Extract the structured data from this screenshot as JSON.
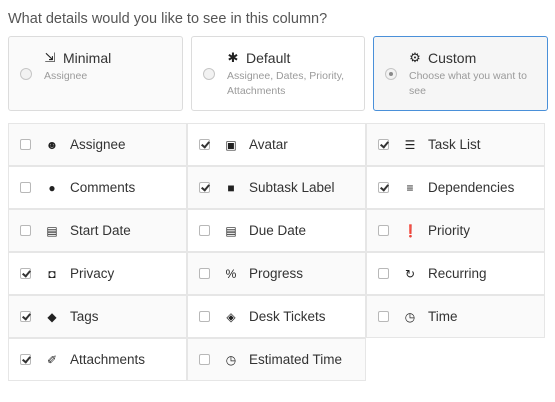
{
  "question": "What details would you like to see in this column?",
  "presets": [
    {
      "title": "Minimal",
      "description": "Assignee",
      "icon": "compress-arrows-icon",
      "glyph": "⇲",
      "selected": false
    },
    {
      "title": "Default",
      "description": "Assignee, Dates, Priority, Attachments",
      "icon": "asterisk-icon",
      "glyph": "✱",
      "selected": false
    },
    {
      "title": "Custom",
      "description": "Choose what you want to see",
      "icon": "gear-icon",
      "glyph": "⚙",
      "selected": true
    }
  ],
  "fields": [
    {
      "label": "Assignee",
      "icon": "user-icon",
      "glyph": "☻",
      "checked": false
    },
    {
      "label": "Avatar",
      "icon": "camera-icon",
      "glyph": "▣",
      "checked": true
    },
    {
      "label": "Task List",
      "icon": "list-icon",
      "glyph": "☰",
      "checked": true
    },
    {
      "label": "Comments",
      "icon": "comment-icon",
      "glyph": "●",
      "checked": false
    },
    {
      "label": "Subtask Label",
      "icon": "square-icon",
      "glyph": "■",
      "checked": true
    },
    {
      "label": "Dependencies",
      "icon": "dependencies-icon",
      "glyph": "≡",
      "checked": true
    },
    {
      "label": "Start Date",
      "icon": "calendar-icon",
      "glyph": "▤",
      "checked": false
    },
    {
      "label": "Due Date",
      "icon": "calendar-icon",
      "glyph": "▤",
      "checked": false
    },
    {
      "label": "Priority",
      "icon": "exclamation-circle-icon",
      "glyph": "❗",
      "checked": false
    },
    {
      "label": "Privacy",
      "icon": "lock-icon",
      "glyph": "◘",
      "checked": true
    },
    {
      "label": "Progress",
      "icon": "percent-icon",
      "glyph": "%",
      "checked": false
    },
    {
      "label": "Recurring",
      "icon": "refresh-icon",
      "glyph": "↻",
      "checked": false
    },
    {
      "label": "Tags",
      "icon": "tag-icon",
      "glyph": "◆",
      "checked": true
    },
    {
      "label": "Desk Tickets",
      "icon": "ticket-icon",
      "glyph": "◈",
      "checked": false
    },
    {
      "label": "Time",
      "icon": "clock-icon",
      "glyph": "◷",
      "checked": false
    },
    {
      "label": "Attachments",
      "icon": "paperclip-icon",
      "glyph": "✐",
      "checked": true
    },
    {
      "label": "Estimated Time",
      "icon": "clock-icon",
      "glyph": "◷",
      "checked": false
    }
  ]
}
